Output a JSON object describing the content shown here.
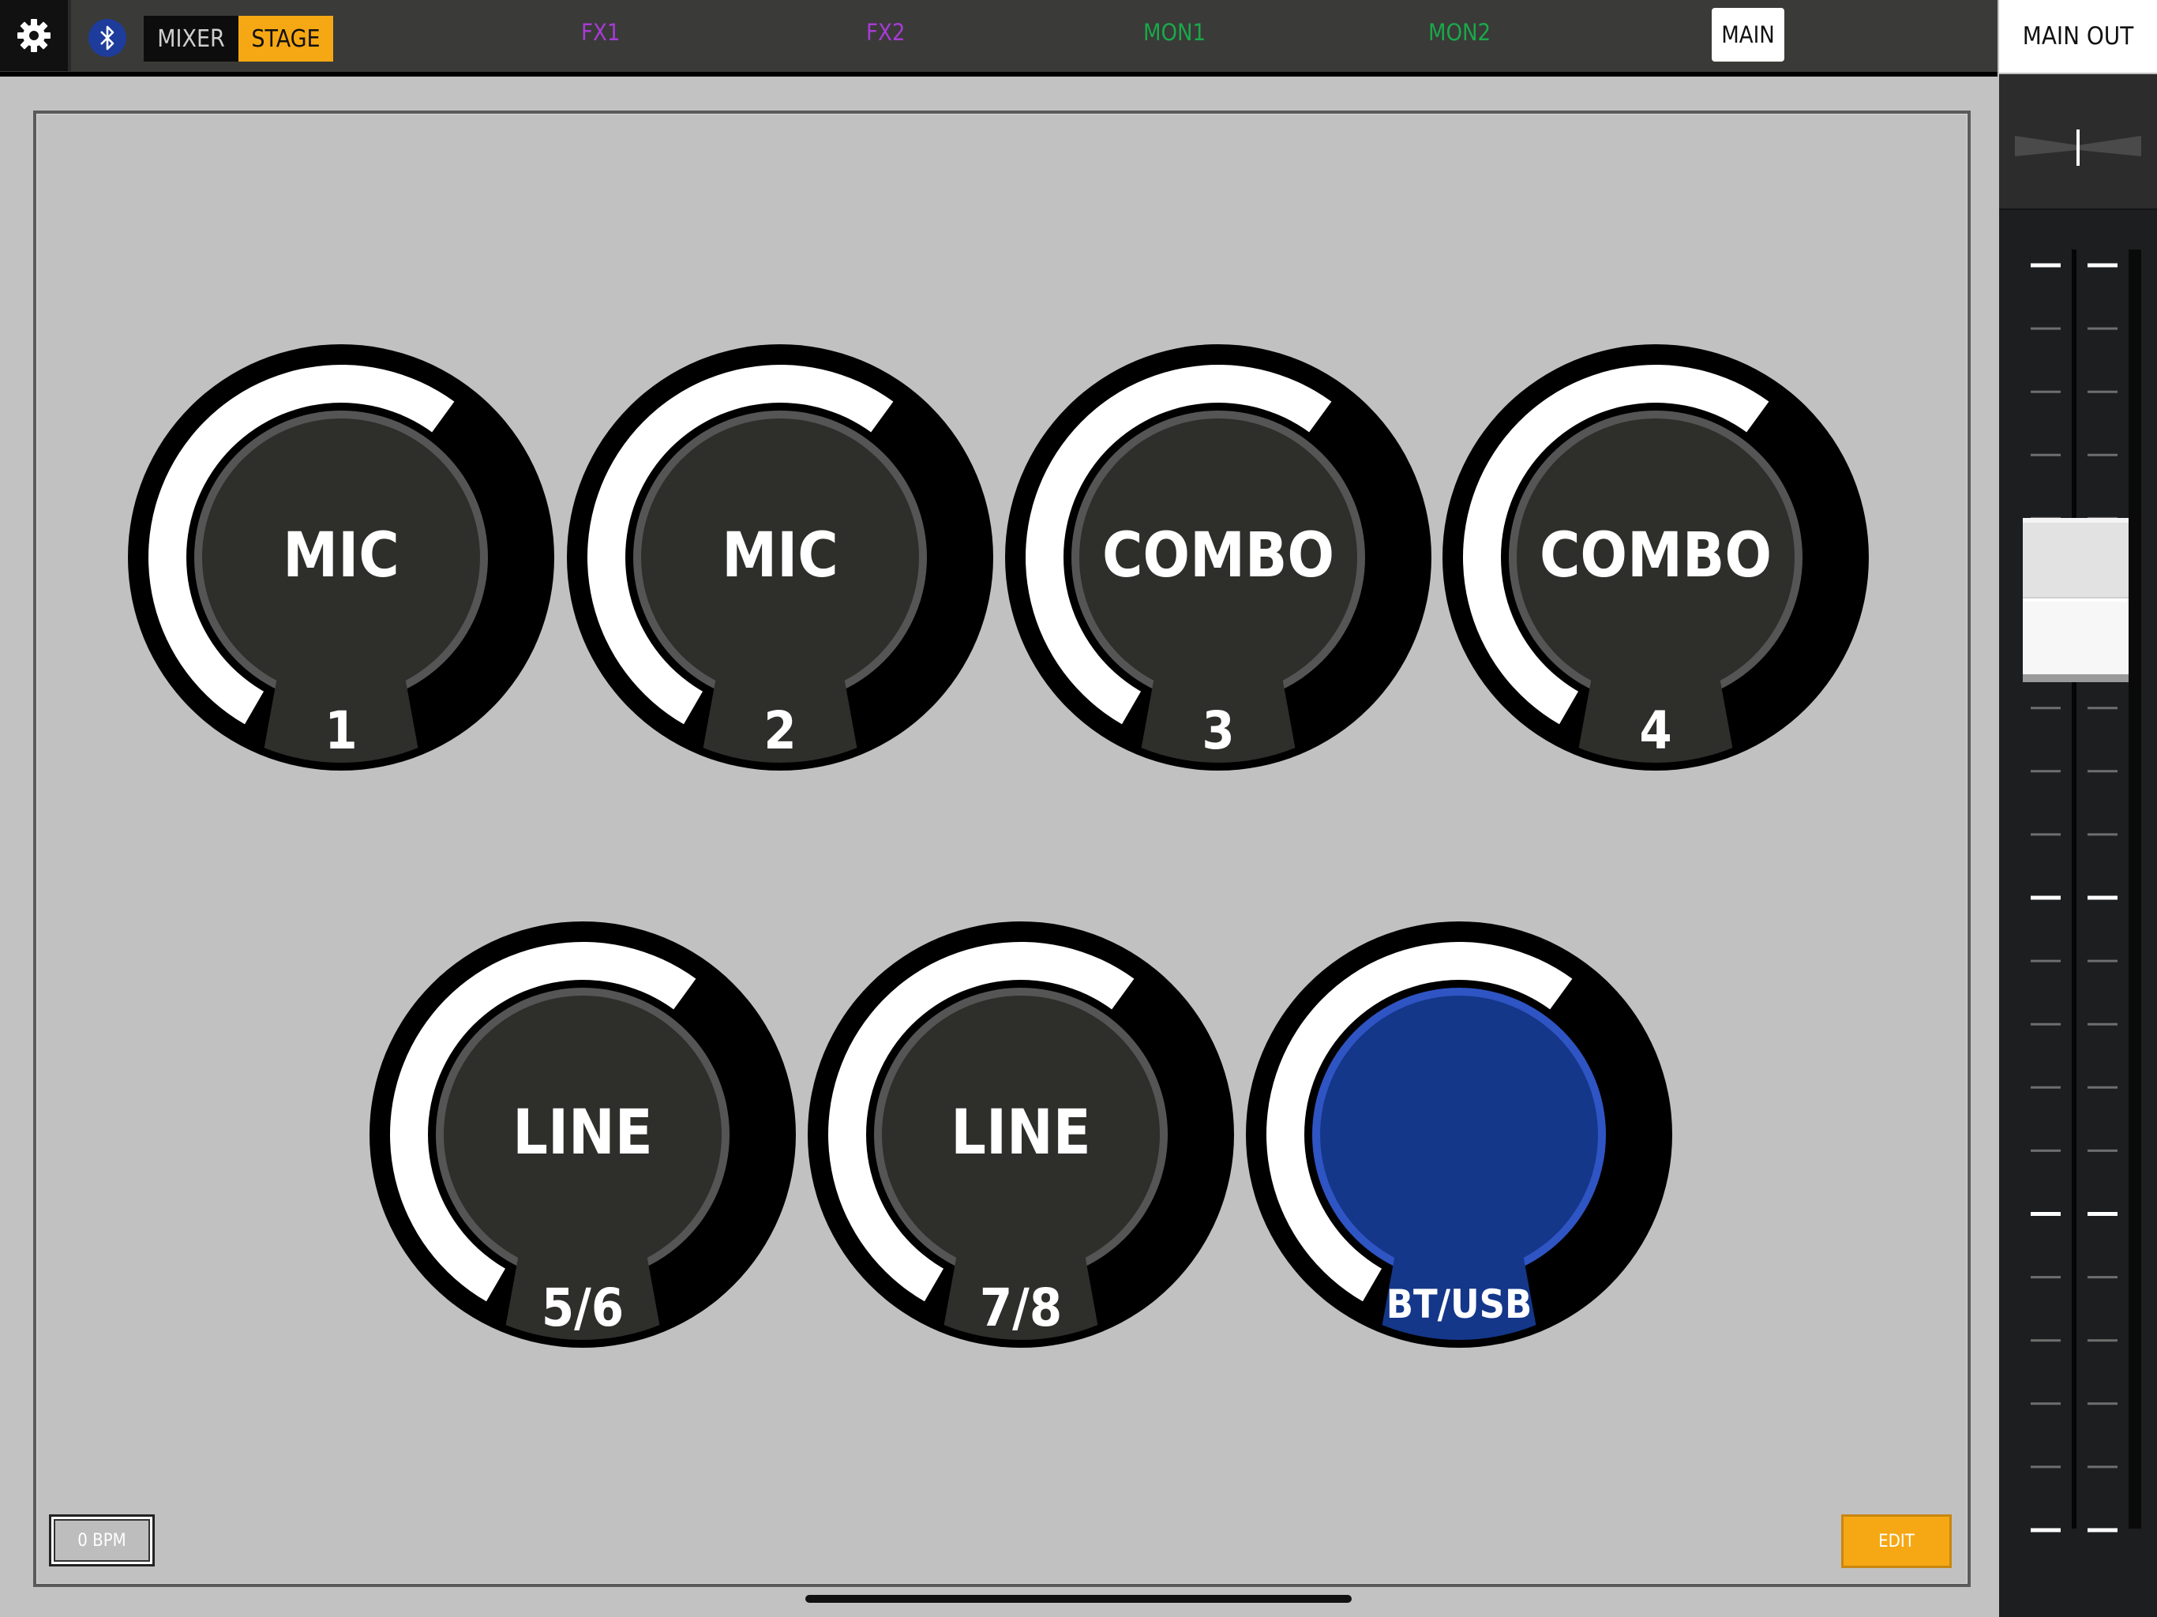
{
  "topbar": {
    "modes": {
      "mixer": "MIXER",
      "stage": "STAGE"
    },
    "buses": {
      "fx1": "FX1",
      "fx2": "FX2",
      "mon1": "MON1",
      "mon2": "MON2",
      "main": "MAIN"
    },
    "main_out": "MAIN OUT"
  },
  "colors": {
    "accent": "#f5a814",
    "fx": "#a73bd6",
    "mon": "#1aa84a",
    "bt_usb": "#14378a",
    "knob_body": "#2e2e2b"
  },
  "channels": [
    {
      "type": "MIC",
      "num": "1",
      "level": 0.62,
      "selected": false
    },
    {
      "type": "MIC",
      "num": "2",
      "level": 0.62,
      "selected": false
    },
    {
      "type": "COMBO",
      "num": "3",
      "level": 0.62,
      "selected": false
    },
    {
      "type": "COMBO",
      "num": "4",
      "level": 0.62,
      "selected": false
    },
    {
      "type": "LINE",
      "num": "5/6",
      "level": 0.62,
      "selected": false
    },
    {
      "type": "LINE",
      "num": "7/8",
      "level": 0.62,
      "selected": false
    },
    {
      "type": "",
      "num": "BT/USB",
      "level": 0.62,
      "selected": true
    }
  ],
  "footer": {
    "bpm": "0 BPM",
    "edit": "EDIT"
  },
  "fader": {
    "level": 0.7
  }
}
